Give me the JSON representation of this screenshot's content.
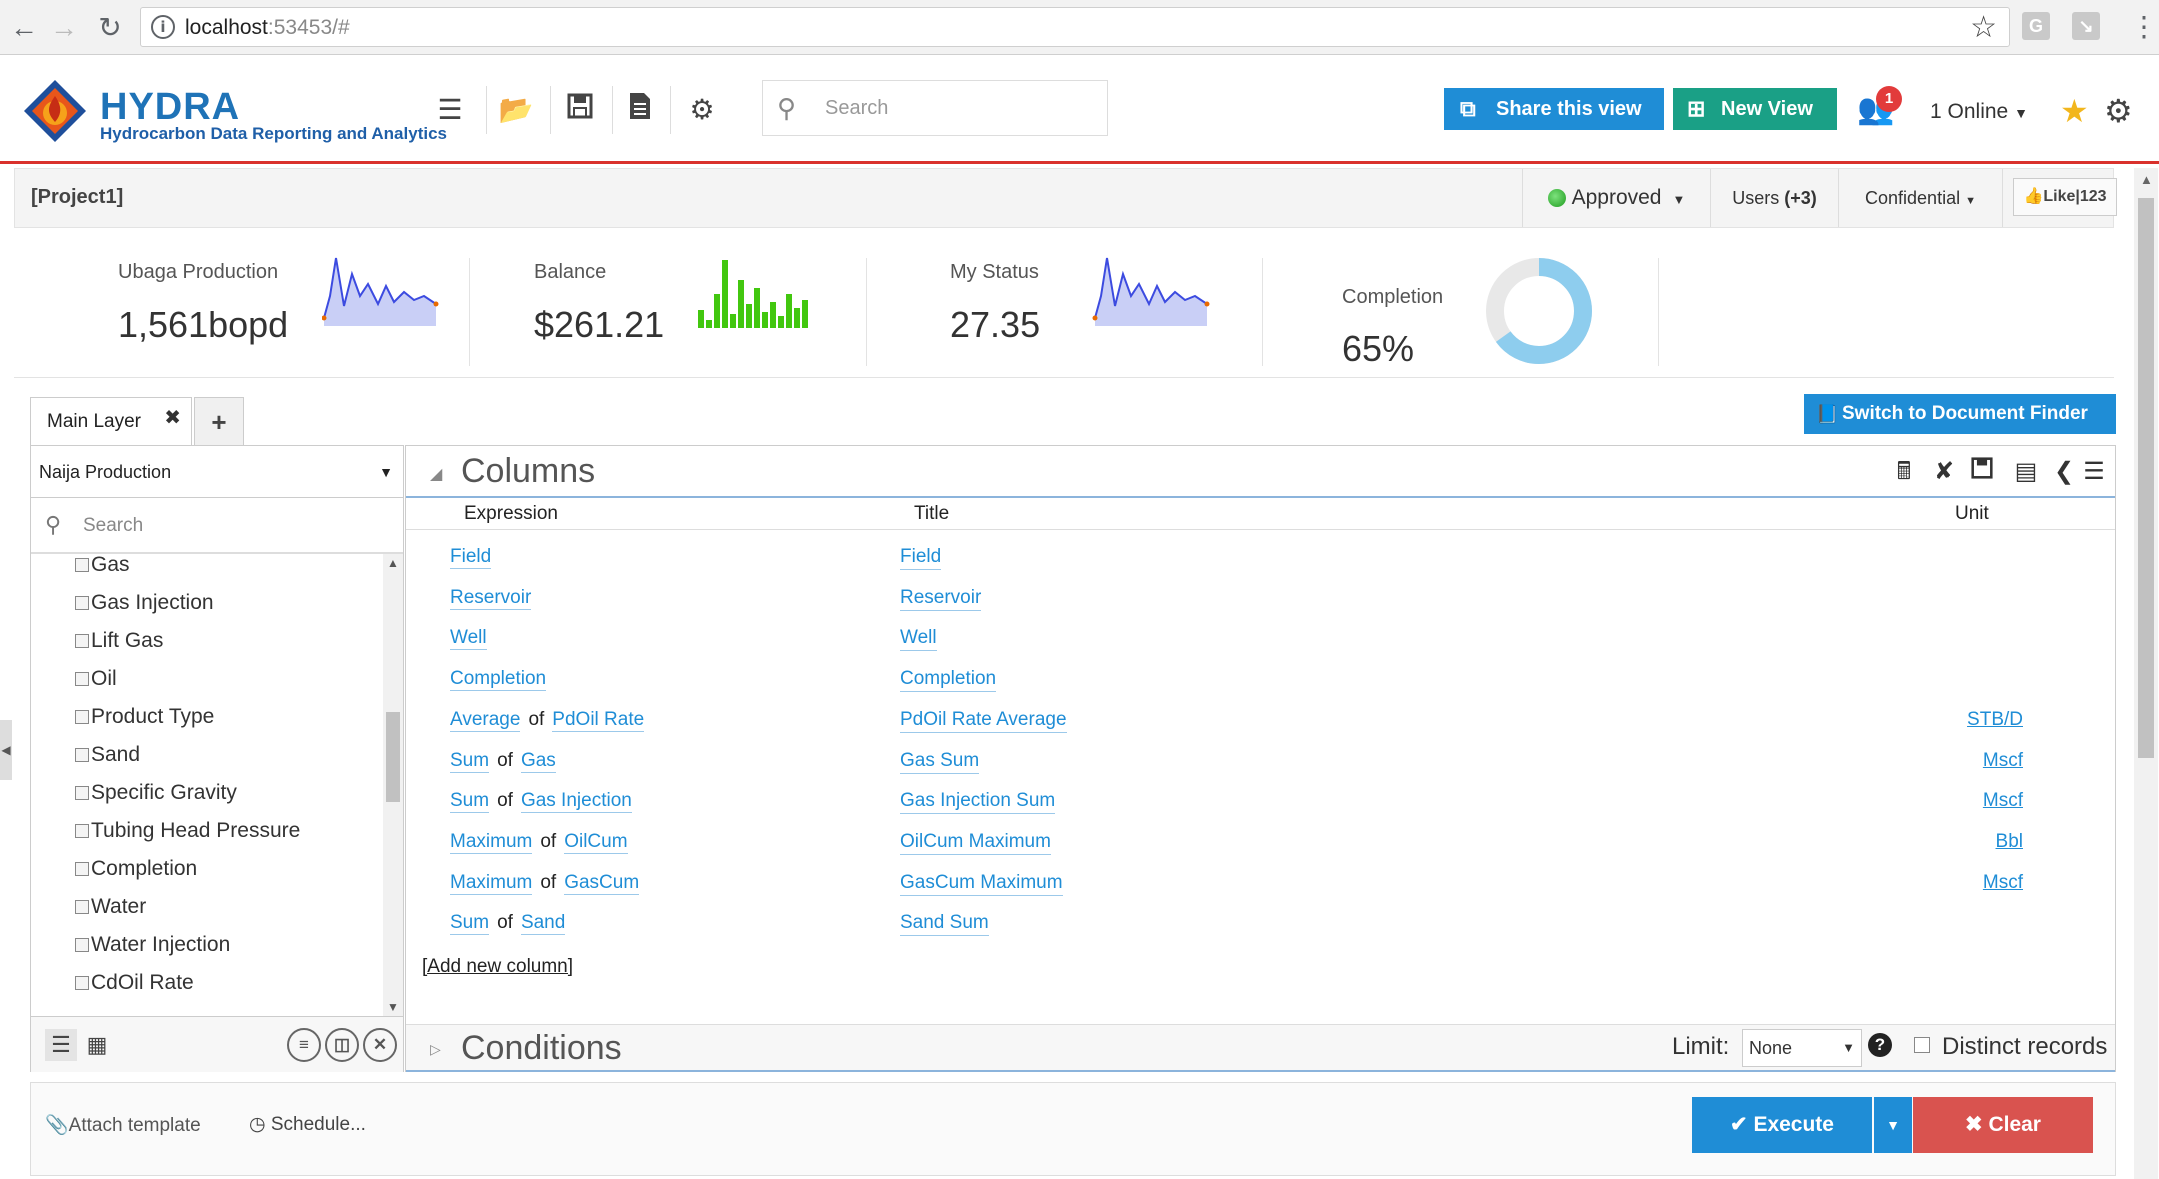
{
  "browser": {
    "url_host": "localhost",
    "url_rest": ":53453/#"
  },
  "header": {
    "brand": "HYDRA",
    "tagline": "Hydrocarbon Data Reporting and Analytics",
    "search_placeholder": "Search",
    "share_label": "Share this view",
    "newview_label": "New View",
    "notifications": "1",
    "online": "1 Online"
  },
  "project": {
    "name": "[Project1]",
    "status": "Approved",
    "users": "Users",
    "users_count": "(+3)",
    "confidential": "Confidential",
    "like": "Like|123"
  },
  "kpis": [
    {
      "label": "Ubaga Production",
      "value": "1,561bopd"
    },
    {
      "label": "Balance",
      "value": "$261.21"
    },
    {
      "label": "My Status",
      "value": "27.35"
    },
    {
      "label": "Completion",
      "value": "65%",
      "fraction": 0.65
    }
  ],
  "layers": {
    "tab": "Main Layer",
    "switch_label": "Switch to Document Finder"
  },
  "left": {
    "dropdown": "Naija Production",
    "search_placeholder": "Search",
    "items": [
      "Gas",
      "Gas Injection",
      "Lift Gas",
      "Oil",
      "Product Type",
      "Sand",
      "Specific Gravity",
      "Tubing Head Pressure",
      "Completion",
      "Water",
      "Water Injection",
      "CdOil Rate"
    ]
  },
  "columns": {
    "title": "Columns",
    "headers": {
      "expression": "Expression",
      "title": "Title",
      "unit": "Unit"
    },
    "rows": [
      {
        "agg": "",
        "field": "Field",
        "title": "Field",
        "unit": ""
      },
      {
        "agg": "",
        "field": "Reservoir",
        "title": "Reservoir",
        "unit": ""
      },
      {
        "agg": "",
        "field": "Well",
        "title": "Well",
        "unit": ""
      },
      {
        "agg": "",
        "field": "Completion",
        "title": "Completion",
        "unit": ""
      },
      {
        "agg": "Average",
        "field": "PdOil Rate",
        "title": "PdOil Rate Average",
        "unit": "STB/D"
      },
      {
        "agg": "Sum",
        "field": "Gas",
        "title": "Gas Sum",
        "unit": "Mscf"
      },
      {
        "agg": "Sum",
        "field": "Gas Injection",
        "title": "Gas Injection Sum",
        "unit": "Mscf"
      },
      {
        "agg": "Maximum",
        "field": "OilCum",
        "title": "OilCum Maximum",
        "unit": "Bbl"
      },
      {
        "agg": "Maximum",
        "field": "GasCum",
        "title": "GasCum Maximum",
        "unit": "Mscf"
      },
      {
        "agg": "Sum",
        "field": "Sand",
        "title": "Sand Sum",
        "unit": ""
      }
    ],
    "of_word": "of",
    "add_label": "[Add new column]"
  },
  "conditions": {
    "title": "Conditions",
    "limit_label": "Limit:",
    "limit_value": "None",
    "distinct_label": "Distinct records"
  },
  "footer": {
    "attach": "Attach template",
    "schedule": "Schedule...",
    "execute": "Execute",
    "clear": "Clear"
  },
  "colors": {
    "accent_blue": "#1f8dd6",
    "accent_teal": "#1aa086",
    "danger": "#d9534f",
    "brand_red": "#d9312c"
  }
}
